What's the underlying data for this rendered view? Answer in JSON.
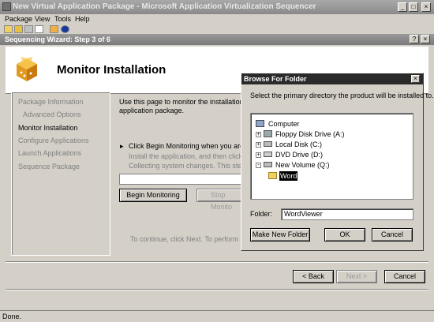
{
  "app": {
    "title": "New Virtual Application Package - Microsoft Application Virtualization Sequencer",
    "window_controls": [
      "_",
      "□",
      "×"
    ]
  },
  "menu": [
    "Package",
    "View",
    "Tools",
    "Help"
  ],
  "wizard": {
    "title": "Sequencing Wizard: Step 3 of 6",
    "help_btn": "?",
    "close_btn": "×",
    "header_title": "Monitor Installation",
    "nav": [
      "Package Information",
      "Advanced Options",
      "Monitor Installation",
      "Configure Applications",
      "Launch Applications",
      "Sequence Package"
    ],
    "intro_line1": "Use this page to monitor the installation proce",
    "intro_line2": "application package.",
    "step_line": "Click Begin Monitoring when you are reac",
    "step_sub1": "Install the application, and then click Stop",
    "step_sub2": "Collecting system changes. This step can",
    "begin_btn": "Begin Monitoring",
    "stop_btn": "Stop Monito",
    "continue_text": "To continue, click Next. To perform anoth",
    "back_btn": "< Back",
    "next_btn": "Next >",
    "cancel_btn": "Cancel"
  },
  "status": "Done.",
  "browse": {
    "title": "Browse For Folder",
    "close": "×",
    "prompt": "Select the primary directory the product will be installed to.",
    "tree": [
      {
        "label": "Computer",
        "expander": "-"
      },
      {
        "label": "Floppy Disk Drive (A:)",
        "expander": "+"
      },
      {
        "label": "Local Disk (C:)",
        "expander": "+"
      },
      {
        "label": "DVD Drive (D:)",
        "expander": "+"
      },
      {
        "label": "New Volume (Q:)",
        "expander": "-"
      },
      {
        "label": "Word",
        "expander": ""
      }
    ],
    "folder_label": "Folder:",
    "folder_value": "WordViewer",
    "make_folder_btn": "Make New Folder",
    "ok_btn": "OK",
    "cancel_btn": "Cancel"
  }
}
